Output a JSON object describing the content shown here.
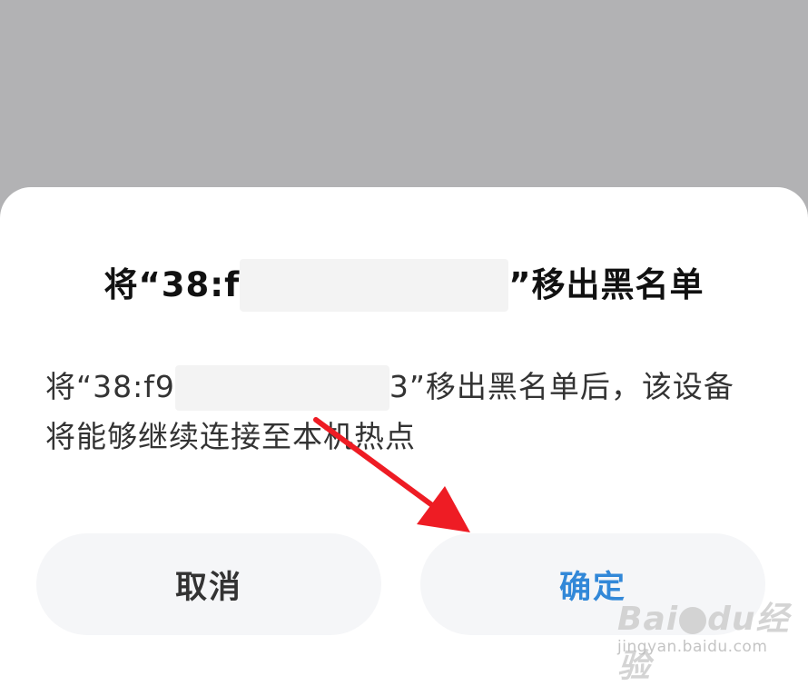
{
  "dialog": {
    "title_prefix": "将“38:f",
    "title_suffix": "”移出黑名单",
    "message_prefix": "将“38:f9",
    "message_mid": "3",
    "message_suffix": "”移出黑名单后，该设备将能够继续连接至本机热点"
  },
  "buttons": {
    "cancel_label": "取消",
    "confirm_label": "确定"
  },
  "annotation": {
    "arrow_icon": "red-arrow-pointing-to-confirm",
    "arrow_color": "#ee1c24"
  },
  "watermark": {
    "logo_text_a": "Bai",
    "logo_text_b": "du",
    "logo_text_c": "经验",
    "url": "jingyan.baidu.com"
  },
  "colors": {
    "overlay": "#b2b2b4",
    "confirm_text": "#3288d8",
    "button_bg": "#f5f6f8"
  }
}
